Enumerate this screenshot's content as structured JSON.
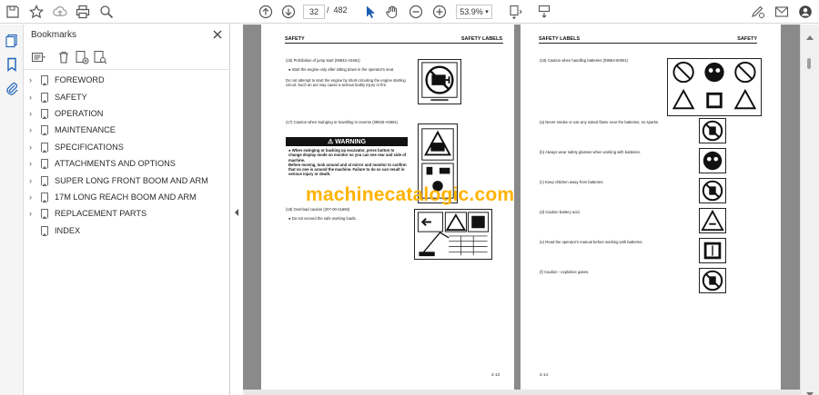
{
  "toolbar": {
    "current_page": "32",
    "page_separator": "/",
    "total_pages": "482",
    "zoom": "53.9%"
  },
  "bookmarks": {
    "title": "Bookmarks",
    "items": [
      {
        "label": "FOREWORD",
        "expandable": true
      },
      {
        "label": "SAFETY",
        "expandable": true
      },
      {
        "label": "OPERATION",
        "expandable": true
      },
      {
        "label": "MAINTENANCE",
        "expandable": true
      },
      {
        "label": "SPECIFICATIONS",
        "expandable": true
      },
      {
        "label": "ATTACHMENTS AND OPTIONS",
        "expandable": true
      },
      {
        "label": "SUPER LONG FRONT BOOM AND ARM",
        "expandable": true
      },
      {
        "label": "17M LONG REACH BOOM AND ARM",
        "expandable": true
      },
      {
        "label": "REPLACEMENT PARTS",
        "expandable": true
      },
      {
        "label": "INDEX",
        "expandable": false
      }
    ]
  },
  "page_left": {
    "header_left": "SAFETY",
    "header_right": "SAFETY LABELS",
    "item15_title": "(15) Prohibition of jump start (09842-A0481)",
    "item15_bullet": "Start the engine only after sitting down in the operator's seat.",
    "item15_text": "Do not attempt to start the engine by short-circuiting the engine starting circuit. Such an act may cause a serious bodily injury or fire.",
    "item17_title": "(17) Caution when swinging or travelling in reverse (09833-A0881)",
    "warning_label": "WARNING",
    "warning_b1": "When swinging or backing up excavator, press button to change display mode on monitor so you can see rear and side of machine.",
    "warning_b2": "Before moving, look around and at mirror and monitor to confirm that no one is around the machine. Failure to do so can result in serious injury or death.",
    "item18_title": "(18) Overload caution (207-00-41660)",
    "item18_bullet": "Do not exceed the safe working loads.",
    "footer": "2-13"
  },
  "page_right": {
    "header_left": "SAFETY LABELS",
    "header_right": "SAFETY",
    "item19_title": "(19) Caution when handling batteries (09664-60001)",
    "items": [
      "(a) Never smoke or use any naked flame near the batteries, no sparks.",
      "(b) Always wear safety glasses when working with batteries.",
      "(c) Keep children away from batteries.",
      "(d) Caution battery acid.",
      "(e) Read the operator's manual before working with batteries.",
      "(f) Caution - explosive gases."
    ],
    "footer": "2-14"
  },
  "watermark": "machinecatalogic.com"
}
